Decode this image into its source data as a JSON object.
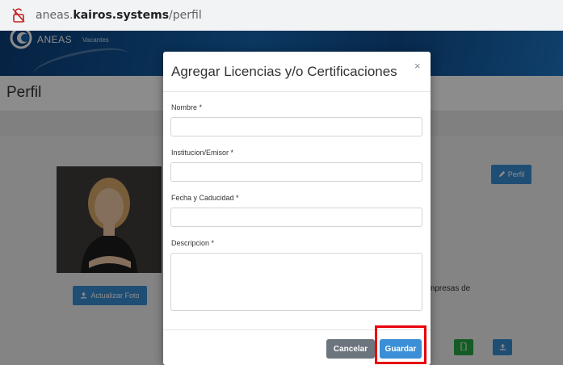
{
  "browser": {
    "url_prefix": "aneas.",
    "url_domain": "kairos.systems",
    "url_path": "/perfil"
  },
  "navbar": {
    "brand": "ANEAS",
    "menu_item": "Vacantes"
  },
  "page": {
    "title": "Perfil",
    "update_photo_label": "Actualizar Foto",
    "profile_button_label": "Perfil",
    "truncated_text": "mpresas de"
  },
  "modal": {
    "title": "Agregar Licencias y/o Certificaciones",
    "close_symbol": "×",
    "fields": {
      "nombre_label": "Nombre *",
      "nombre_value": "",
      "institucion_label": "Institucion/Emisor *",
      "institucion_value": "",
      "fecha_label": "Fecha y Caducidad *",
      "fecha_value": "",
      "descripcion_label": "Descripcion *",
      "descripcion_value": ""
    },
    "cancel_label": "Cancelar",
    "save_label": "Guardar"
  },
  "colors": {
    "primary": "#3a8fd6",
    "secondary": "#6c757d",
    "success": "#28a745",
    "highlight": "#e8000b",
    "navbar": "#1565b0"
  },
  "icons": {
    "address_bar": "broken-lock-icon",
    "logo": "aneas-logo-icon",
    "upload": "upload-icon",
    "pencil": "pencil-icon",
    "document": "document-icon",
    "close": "close-icon"
  }
}
